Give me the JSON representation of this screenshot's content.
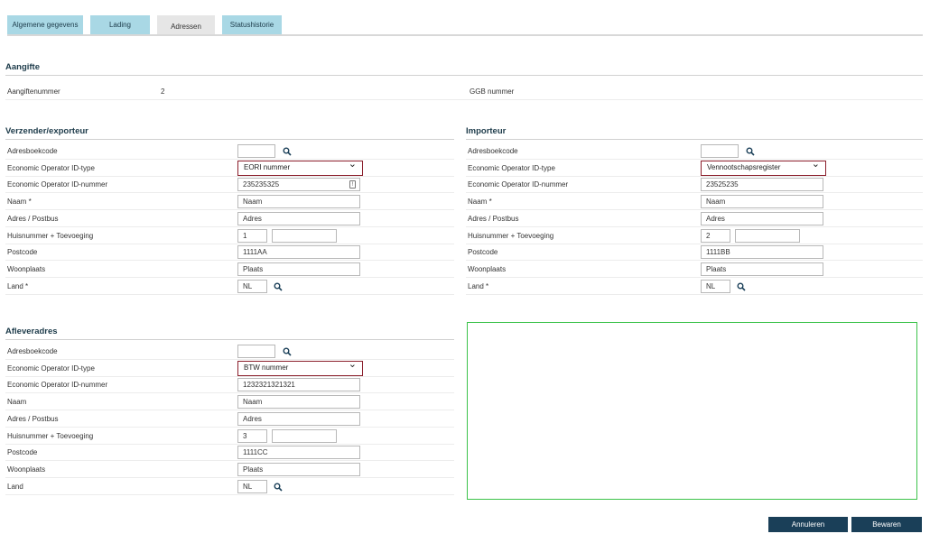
{
  "tabs": [
    "Algemene gegevens",
    "Lading",
    "Adressen",
    "Statushistorie"
  ],
  "aangifte": {
    "title": "Aangifte",
    "nummer_label": "Aangiftenummer",
    "nummer_value": "2",
    "ggb_label": "GGB nummer"
  },
  "verzender": {
    "title": "Verzender/exporteur",
    "labels": {
      "adresboekcode": "Adresboekcode",
      "eo_type": "Economic Operator ID-type",
      "eo_nummer": "Economic Operator ID-nummer",
      "naam": "Naam *",
      "adres": "Adres / Postbus",
      "huisnummer": "Huisnummer + Toevoeging",
      "postcode": "Postcode",
      "woonplaats": "Woonplaats",
      "land": "Land *"
    },
    "values": {
      "adresboekcode": "",
      "eo_type": "EORI nummer",
      "eo_nummer": "235235325",
      "naam": "Naam",
      "adres": "Adres",
      "huisnummer": "1",
      "toevoeging": "",
      "postcode": "1111AA",
      "woonplaats": "Plaats",
      "land": "NL"
    }
  },
  "importeur": {
    "title": "Importeur",
    "labels": {
      "adresboekcode": "Adresboekcode",
      "eo_type": "Economic Operator ID-type",
      "eo_nummer": "Economic Operator ID-nummer",
      "naam": "Naam *",
      "adres": "Adres / Postbus",
      "huisnummer": "Huisnummer + Toevoeging",
      "postcode": "Postcode",
      "woonplaats": "Woonplaats",
      "land": "Land *"
    },
    "values": {
      "adresboekcode": "",
      "eo_type": "Vennootschapsregister",
      "eo_nummer": "23525235",
      "naam": "Naam",
      "adres": "Adres",
      "huisnummer": "2",
      "toevoeging": "",
      "postcode": "1111BB",
      "woonplaats": "Plaats",
      "land": "NL"
    }
  },
  "afleveradres": {
    "title": "Afleveradres",
    "labels": {
      "adresboekcode": "Adresboekcode",
      "eo_type": "Economic Operator ID-type",
      "eo_nummer": "Economic Operator ID-nummer",
      "naam": "Naam",
      "adres": "Adres / Postbus",
      "huisnummer": "Huisnummer + Toevoeging",
      "postcode": "Postcode",
      "woonplaats": "Woonplaats",
      "land": "Land"
    },
    "values": {
      "adresboekcode": "",
      "eo_type": "BTW nummer",
      "eo_nummer": "1232321321321",
      "naam": "Naam",
      "adres": "Adres",
      "huisnummer": "3",
      "toevoeging": "",
      "postcode": "1111CC",
      "woonplaats": "Plaats",
      "land": "NL"
    }
  },
  "buttons": {
    "cancel": "Annuleren",
    "save": "Bewaren"
  },
  "colors": {
    "tab": "#a9d8e5",
    "tab_active": "#e6e6e6",
    "select_border": "#8b1e2b",
    "button": "#1a3f58",
    "map_border": "#3cc34a"
  }
}
